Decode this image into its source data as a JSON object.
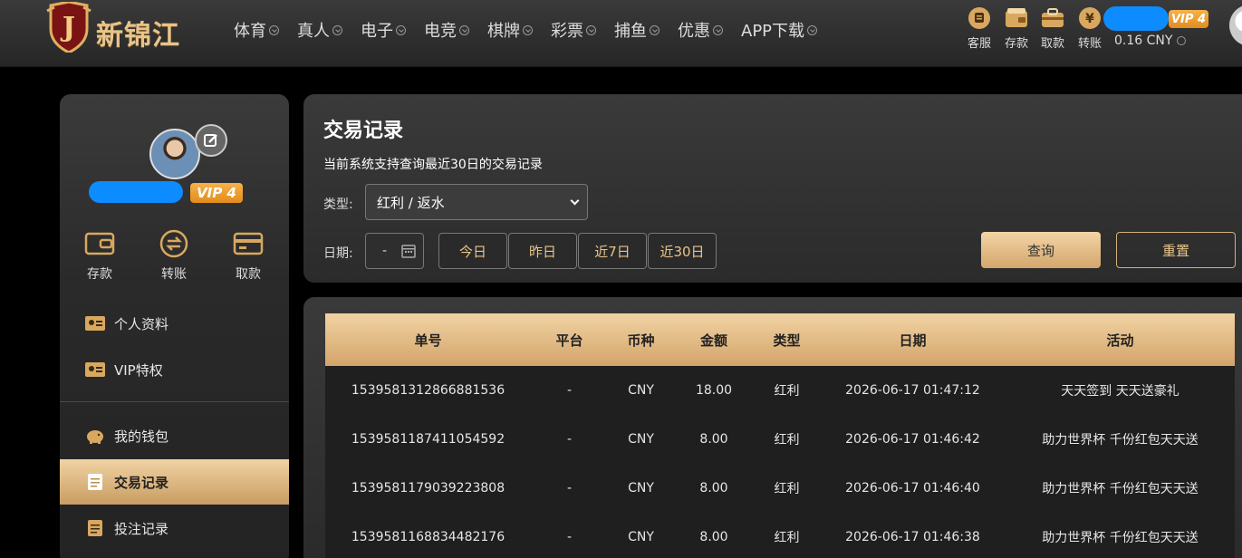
{
  "brand": {
    "name": "新锦江",
    "shield_letter": "J"
  },
  "nav": [
    {
      "label": "体育"
    },
    {
      "label": "真人"
    },
    {
      "label": "电子"
    },
    {
      "label": "电竞"
    },
    {
      "label": "棋牌"
    },
    {
      "label": "彩票"
    },
    {
      "label": "捕鱼"
    },
    {
      "label": "优惠"
    },
    {
      "label": "APP下载"
    }
  ],
  "quick_links": [
    {
      "label": "客服",
      "icon": "chat-icon"
    },
    {
      "label": "存款",
      "icon": "wallet-icon"
    },
    {
      "label": "取款",
      "icon": "bag-icon"
    },
    {
      "label": "转账",
      "icon": "coin-transfer-icon"
    }
  ],
  "account": {
    "vip": "VIP 4",
    "balance": "0.16 CNY"
  },
  "sidebar": {
    "vip": "VIP 4",
    "actions": [
      {
        "label": "存款",
        "icon": "wallet-icon"
      },
      {
        "label": "转账",
        "icon": "transfer-icon"
      },
      {
        "label": "取款",
        "icon": "card-icon"
      }
    ],
    "menu": [
      {
        "label": "个人资料",
        "icon": "id-card-icon"
      },
      {
        "label": "VIP特权",
        "icon": "id-card-icon"
      },
      {
        "label": "我的钱包",
        "icon": "piggy-bank-icon"
      },
      {
        "label": "交易记录",
        "icon": "document-icon",
        "active": true
      },
      {
        "label": "投注记录",
        "icon": "document-icon"
      }
    ]
  },
  "filter": {
    "title": "交易记录",
    "subtitle": "当前系统支持查询最近30日的交易记录",
    "type_label": "类型:",
    "type_value": "红利 / 返水",
    "date_label": "日期:",
    "date_value": "-",
    "quick_dates": [
      "今日",
      "昨日",
      "近7日",
      "近30日"
    ],
    "query_label": "查询",
    "reset_label": "重置"
  },
  "table": {
    "headers": [
      "单号",
      "平台",
      "币种",
      "金额",
      "类型",
      "日期",
      "活动"
    ],
    "rows": [
      [
        "1539581312866881536",
        "-",
        "CNY",
        "18.00",
        "红利",
        "2026-06-17 01:47:12",
        "天天签到 天天送豪礼"
      ],
      [
        "1539581187411054592",
        "-",
        "CNY",
        "8.00",
        "红利",
        "2026-06-17 01:46:42",
        "助力世界杯 千份红包天天送"
      ],
      [
        "1539581179039223808",
        "-",
        "CNY",
        "8.00",
        "红利",
        "2026-06-17 01:46:40",
        "助力世界杯 千份红包天天送"
      ],
      [
        "1539581168834482176",
        "-",
        "CNY",
        "8.00",
        "红利",
        "2026-06-17 01:46:38",
        "助力世界杯 千份红包天天送"
      ]
    ]
  },
  "colors": {
    "gold": "#e8c48a",
    "vip_orange": "#f0a030",
    "mask_blue": "#0d8cff"
  }
}
